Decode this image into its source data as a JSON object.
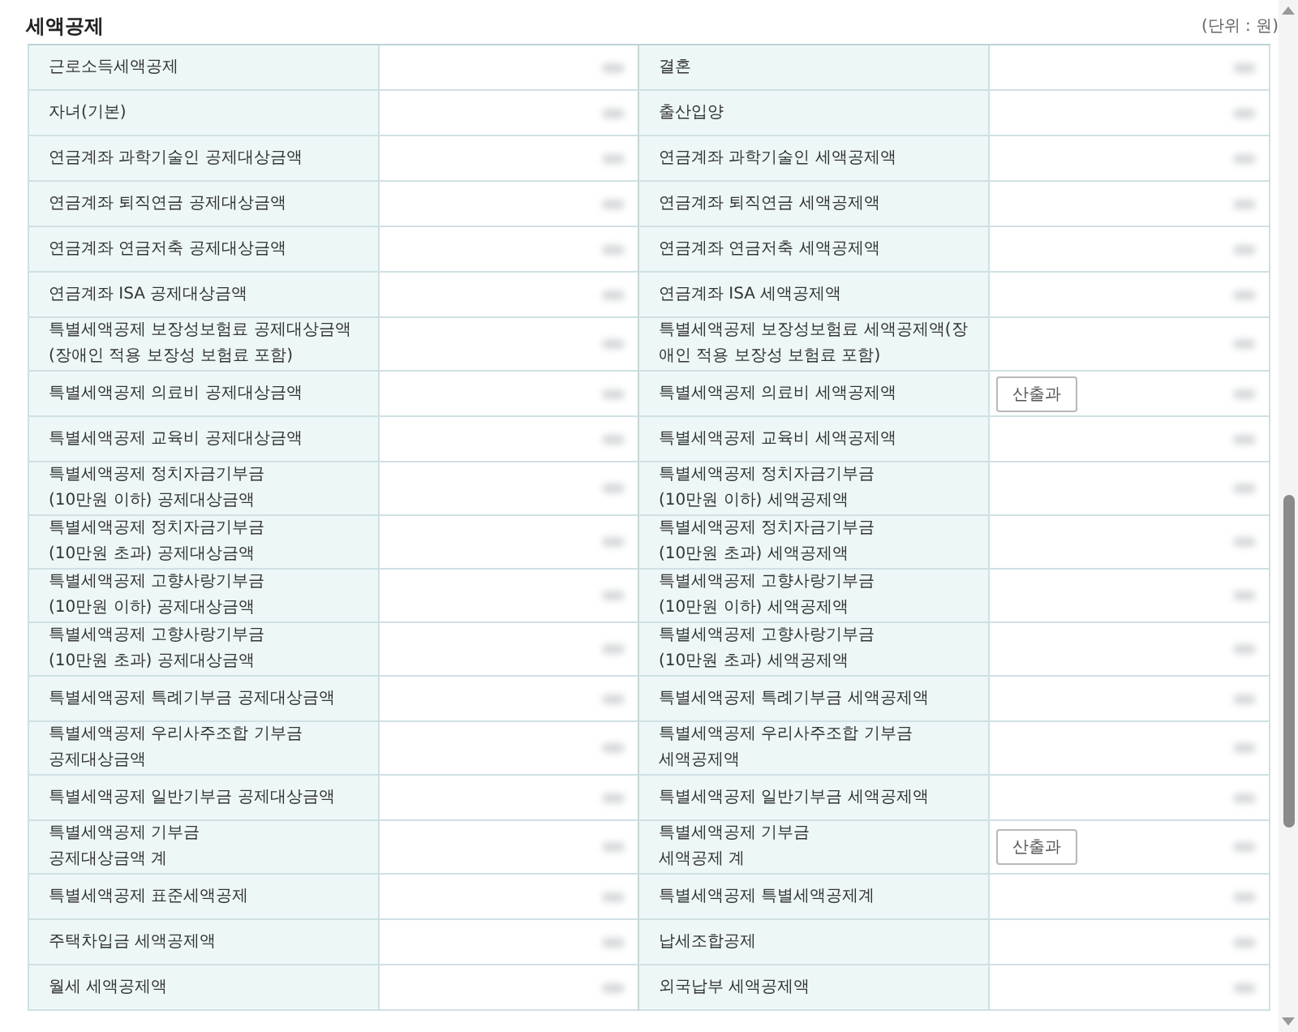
{
  "section": {
    "title": "세액공제",
    "unit": "(단위 : 원)"
  },
  "rows": [
    {
      "left": {
        "label": "근로소득세액공제"
      },
      "right": {
        "label": "결혼"
      }
    },
    {
      "left": {
        "label": "자녀(기본)"
      },
      "right": {
        "label": "출산입양"
      }
    },
    {
      "left": {
        "label": "연금계좌 과학기술인 공제대상금액"
      },
      "right": {
        "label": "연금계좌 과학기술인 세액공제액"
      }
    },
    {
      "left": {
        "label": "연금계좌 퇴직연금 공제대상금액"
      },
      "right": {
        "label": "연금계좌 퇴직연금 세액공제액"
      }
    },
    {
      "left": {
        "label": "연금계좌 연금저축 공제대상금액"
      },
      "right": {
        "label": "연금계좌 연금저축 세액공제액"
      }
    },
    {
      "left": {
        "label": "연금계좌 ISA 공제대상금액"
      },
      "right": {
        "label": "연금계좌 ISA 세액공제액"
      }
    },
    {
      "left": {
        "label": "특별세액공제 보장성보험료 공제대상금액\n(장애인 적용 보장성 보험료 포함)"
      },
      "right": {
        "label": "특별세액공제 보장성보험료 세액공제액(장\n애인 적용 보장성 보험료 포함)"
      }
    },
    {
      "left": {
        "label": "특별세액공제 의료비 공제대상금액"
      },
      "right": {
        "label": "특별세액공제 의료비 세액공제액",
        "button": "산출과"
      }
    },
    {
      "left": {
        "label": "특별세액공제 교육비 공제대상금액"
      },
      "right": {
        "label": "특별세액공제 교육비 세액공제액"
      }
    },
    {
      "left": {
        "label": "특별세액공제 정치자금기부금\n(10만원 이하) 공제대상금액"
      },
      "right": {
        "label": "특별세액공제 정치자금기부금\n(10만원 이하) 세액공제액"
      }
    },
    {
      "left": {
        "label": "특별세액공제 정치자금기부금\n(10만원 초과) 공제대상금액"
      },
      "right": {
        "label": "특별세액공제 정치자금기부금\n(10만원 초과) 세액공제액"
      }
    },
    {
      "left": {
        "label": "특별세액공제 고향사랑기부금\n(10만원 이하) 공제대상금액"
      },
      "right": {
        "label": "특별세액공제 고향사랑기부금\n(10만원 이하) 세액공제액"
      }
    },
    {
      "left": {
        "label": "특별세액공제 고향사랑기부금\n(10만원 초과) 공제대상금액"
      },
      "right": {
        "label": "특별세액공제 고향사랑기부금\n(10만원 초과) 세액공제액"
      }
    },
    {
      "left": {
        "label": "특별세액공제 특례기부금 공제대상금액"
      },
      "right": {
        "label": "특별세액공제 특례기부금 세액공제액"
      }
    },
    {
      "left": {
        "label": "특별세액공제 우리사주조합 기부금\n공제대상금액"
      },
      "right": {
        "label": "특별세액공제 우리사주조합 기부금\n세액공제액"
      }
    },
    {
      "left": {
        "label": "특별세액공제 일반기부금 공제대상금액"
      },
      "right": {
        "label": "특별세액공제 일반기부금 세액공제액"
      }
    },
    {
      "left": {
        "label": "특별세액공제 기부금\n공제대상금액 계"
      },
      "right": {
        "label": "특별세액공제 기부금\n세액공제 계",
        "button": "산출과"
      }
    },
    {
      "left": {
        "label": "특별세액공제 표준세액공제"
      },
      "right": {
        "label": "특별세액공제 특별세액공제계"
      }
    },
    {
      "left": {
        "label": "주택차입금 세액공제액"
      },
      "right": {
        "label": "납세조합공제"
      }
    },
    {
      "left": {
        "label": "월세 세액공제액"
      },
      "right": {
        "label": "외국납부 세액공제액"
      }
    }
  ]
}
